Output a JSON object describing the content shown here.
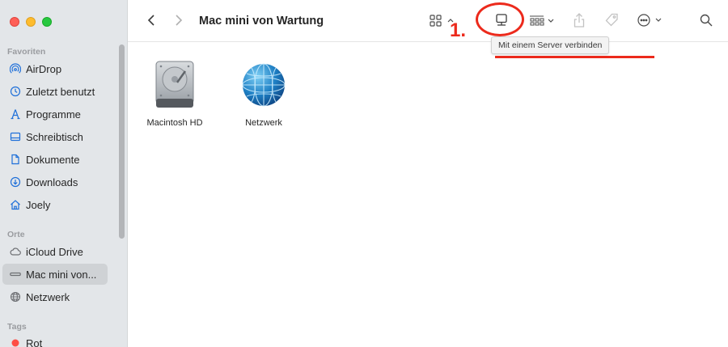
{
  "window": {
    "title": "Mac mini von Wartung"
  },
  "sidebar": {
    "sections": {
      "favorites": "Favoriten",
      "locations": "Orte",
      "tags": "Tags"
    },
    "favorites": [
      {
        "label": "AirDrop",
        "icon": "airdrop-icon"
      },
      {
        "label": "Zuletzt benutzt",
        "icon": "clock-icon"
      },
      {
        "label": "Programme",
        "icon": "apps-icon"
      },
      {
        "label": "Schreibtisch",
        "icon": "desktop-icon"
      },
      {
        "label": "Dokumente",
        "icon": "document-icon"
      },
      {
        "label": "Downloads",
        "icon": "download-icon"
      },
      {
        "label": "Joely",
        "icon": "home-icon"
      }
    ],
    "locations": [
      {
        "label": "iCloud Drive",
        "icon": "cloud-icon"
      },
      {
        "label": "Mac mini von...",
        "icon": "computer-icon",
        "selected": true
      },
      {
        "label": "Netzwerk",
        "icon": "globe-icon"
      }
    ],
    "tags": [
      {
        "label": "Rot",
        "color": "#fe4d45"
      }
    ]
  },
  "toolbar": {
    "tooltip": "Mit einem Server verbinden",
    "annotation_number": "1."
  },
  "content": {
    "items": [
      {
        "label": "Macintosh HD",
        "icon": "hard-drive-icon"
      },
      {
        "label": "Netzwerk",
        "icon": "network-globe-icon"
      }
    ]
  },
  "colors": {
    "accent": "#1e6fd9",
    "annotation": "#ec2a1c",
    "sidebar_bg": "#e3e6e9"
  }
}
